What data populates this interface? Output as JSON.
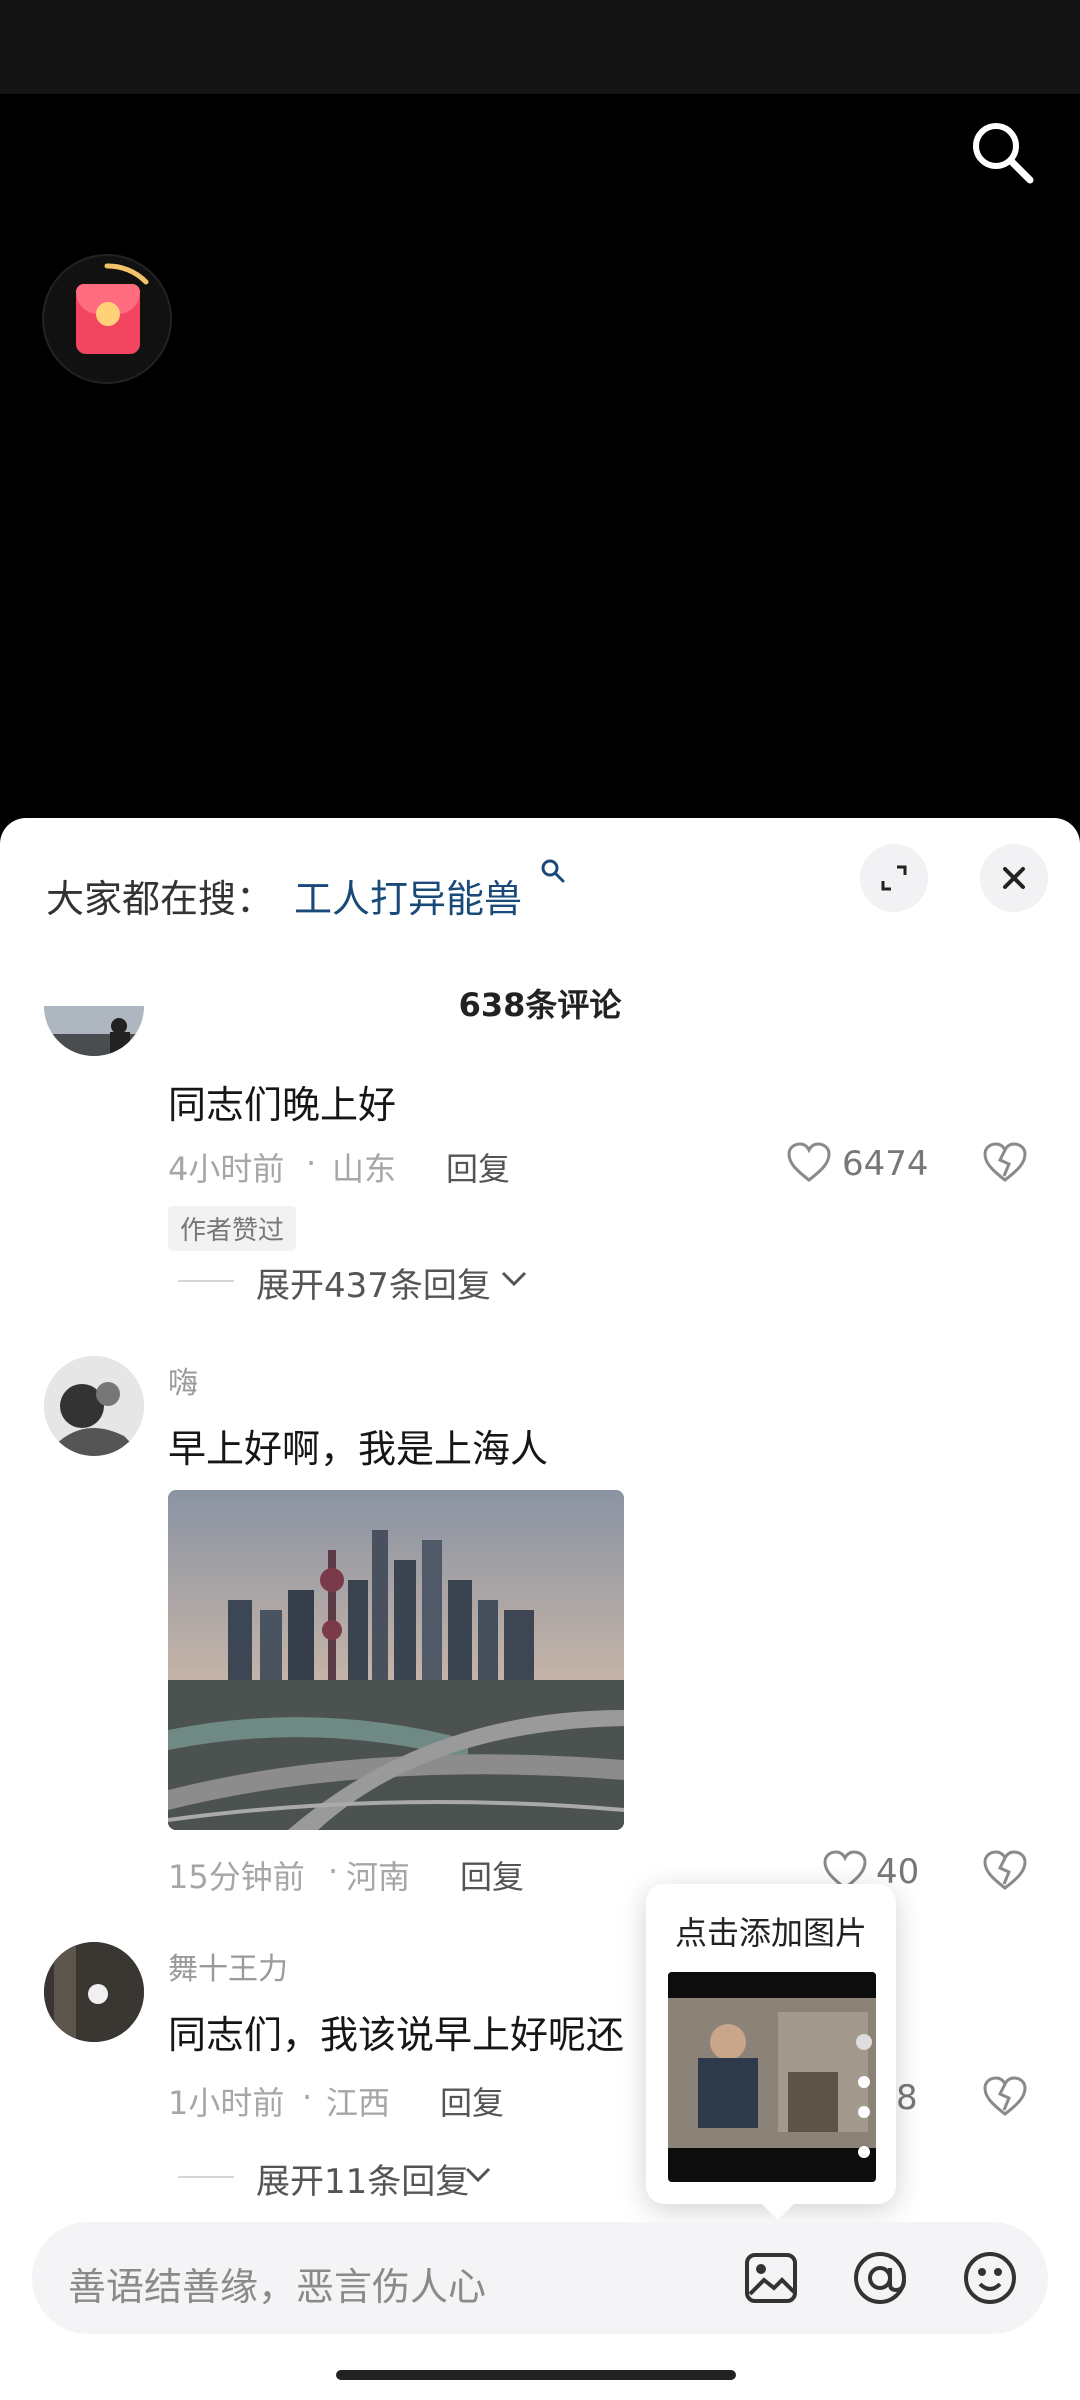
{
  "hot_search": {
    "label": "大家都在搜：",
    "keyword": "工人打异能兽"
  },
  "comments_title": "638条评论",
  "comments": [
    {
      "username": "",
      "text": "同志们晚上好",
      "time": "4小时前",
      "location": "山东",
      "reply_label": "回复",
      "likes": "6474",
      "badge": "作者赞过",
      "expand": "展开437条回复"
    },
    {
      "username": "嗨",
      "text": "早上好啊，我是上海人",
      "time": "15分钟前",
      "location": "河南",
      "reply_label": "回复",
      "likes": "40"
    },
    {
      "username": "舞十王力",
      "text": "同志们，我该说早上好呢还",
      "time": "1小时前",
      "location": "江西",
      "reply_label": "回复",
      "likes": "8",
      "expand": "展开11条回复"
    }
  ],
  "tooltip": {
    "title": "点击添加图片"
  },
  "input": {
    "placeholder": "善语结善缘，恶言伤人心"
  },
  "icons": [
    "search-icon",
    "red-packet-icon",
    "expand-icon",
    "close-icon",
    "heart-icon",
    "dislike-icon",
    "chevron-down-icon",
    "image-icon",
    "at-icon",
    "emoji-icon"
  ],
  "colors": {
    "accent_link": "#1a4a7a",
    "sheet_bg": "#ffffff",
    "video_bg": "#000000"
  }
}
